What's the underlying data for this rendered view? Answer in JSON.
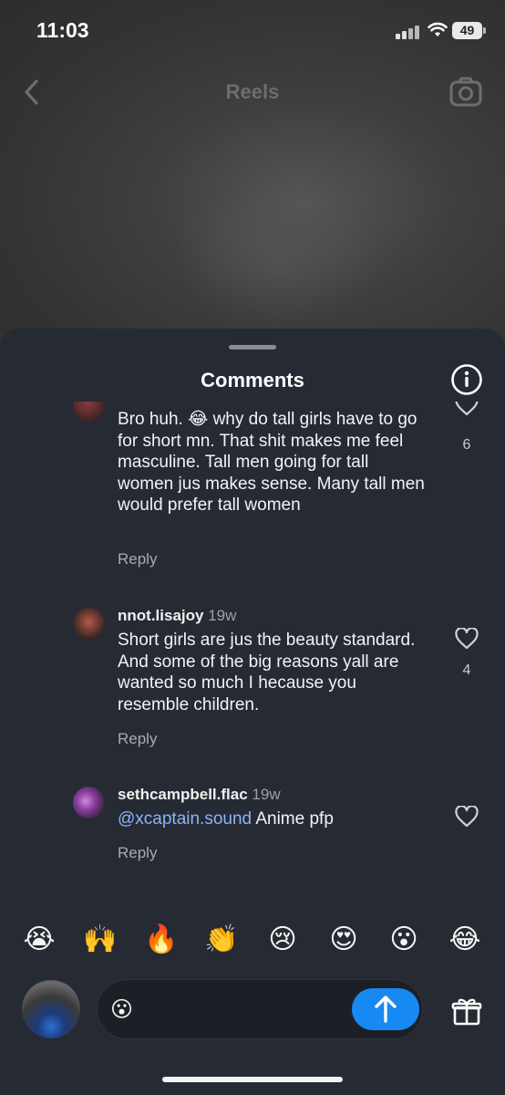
{
  "status_bar": {
    "time": "11:03",
    "battery": "49"
  },
  "nav": {
    "title": "Reels",
    "back_icon": "chevron-left-icon",
    "camera_icon": "camera-icon"
  },
  "sheet": {
    "title": "Comments",
    "info_icon": "info-icon"
  },
  "comments": [
    {
      "text": "Bro huh. 😂 why do tall girls have to go for short mn. That shit makes me feel masculine. Tall men going for tall women jus makes sense. Many tall men would prefer tall women",
      "likes": "6",
      "reply_label": "Reply"
    },
    {
      "username": "nnot.lisajoy",
      "time": "19w",
      "text": "Short girls are jus the beauty standard. And some of the big reasons yall are wanted so much I hecause you resemble children.",
      "likes": "4",
      "reply_label": "Reply"
    },
    {
      "username": "sethcampbell.flac",
      "time": "19w",
      "mention": "@xcaptain.sound",
      "text": " Anime pfp",
      "reply_label": "Reply"
    }
  ],
  "emoji_bar": [
    "😭",
    "🙌",
    "🔥",
    "👏",
    "😢",
    "😍",
    "😮",
    "😂"
  ],
  "composer": {
    "emoji": "😮",
    "input_value": "",
    "send_icon": "arrow-up-icon",
    "gift_icon": "gift-icon"
  }
}
